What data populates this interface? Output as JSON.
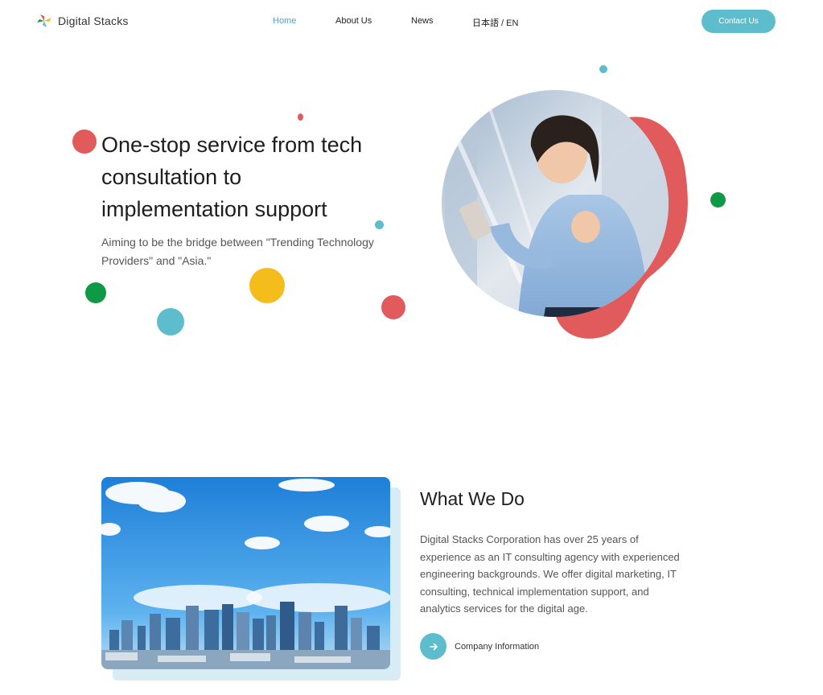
{
  "header": {
    "logo_text": "Digital Stacks",
    "nav": [
      {
        "label": "Home",
        "active": true
      },
      {
        "label": "About Us"
      },
      {
        "label": "News"
      },
      {
        "label": "日本語 / EN"
      }
    ],
    "contact_label": "Contact Us"
  },
  "hero": {
    "title_lines": [
      "One-stop service from tech",
      "consultation to",
      "implementation support"
    ],
    "subtitle_lines": [
      "Aiming to be the bridge between \"Trending Technology",
      "Providers\" and \"Asia.\""
    ]
  },
  "what_we_do": {
    "title": "What We Do",
    "body_lines": [
      "Digital Stacks Corporation has over 25 years of",
      "experience as an IT consulting agency with experienced",
      "engineering backgrounds. We offer digital marketing, IT",
      "consulting, technical implementation support, and",
      "analytics services for the digital age."
    ],
    "link_label": "Company Information"
  },
  "colors": {
    "accent": "#5ebdcc",
    "red": "#e15b5c",
    "green": "#0d9a45",
    "yellow": "#f4bd1b",
    "light_blue": "#d7ecf5"
  },
  "icons": {
    "logo": "pinwheel-logo-icon",
    "arrow": "arrow-right-icon"
  }
}
